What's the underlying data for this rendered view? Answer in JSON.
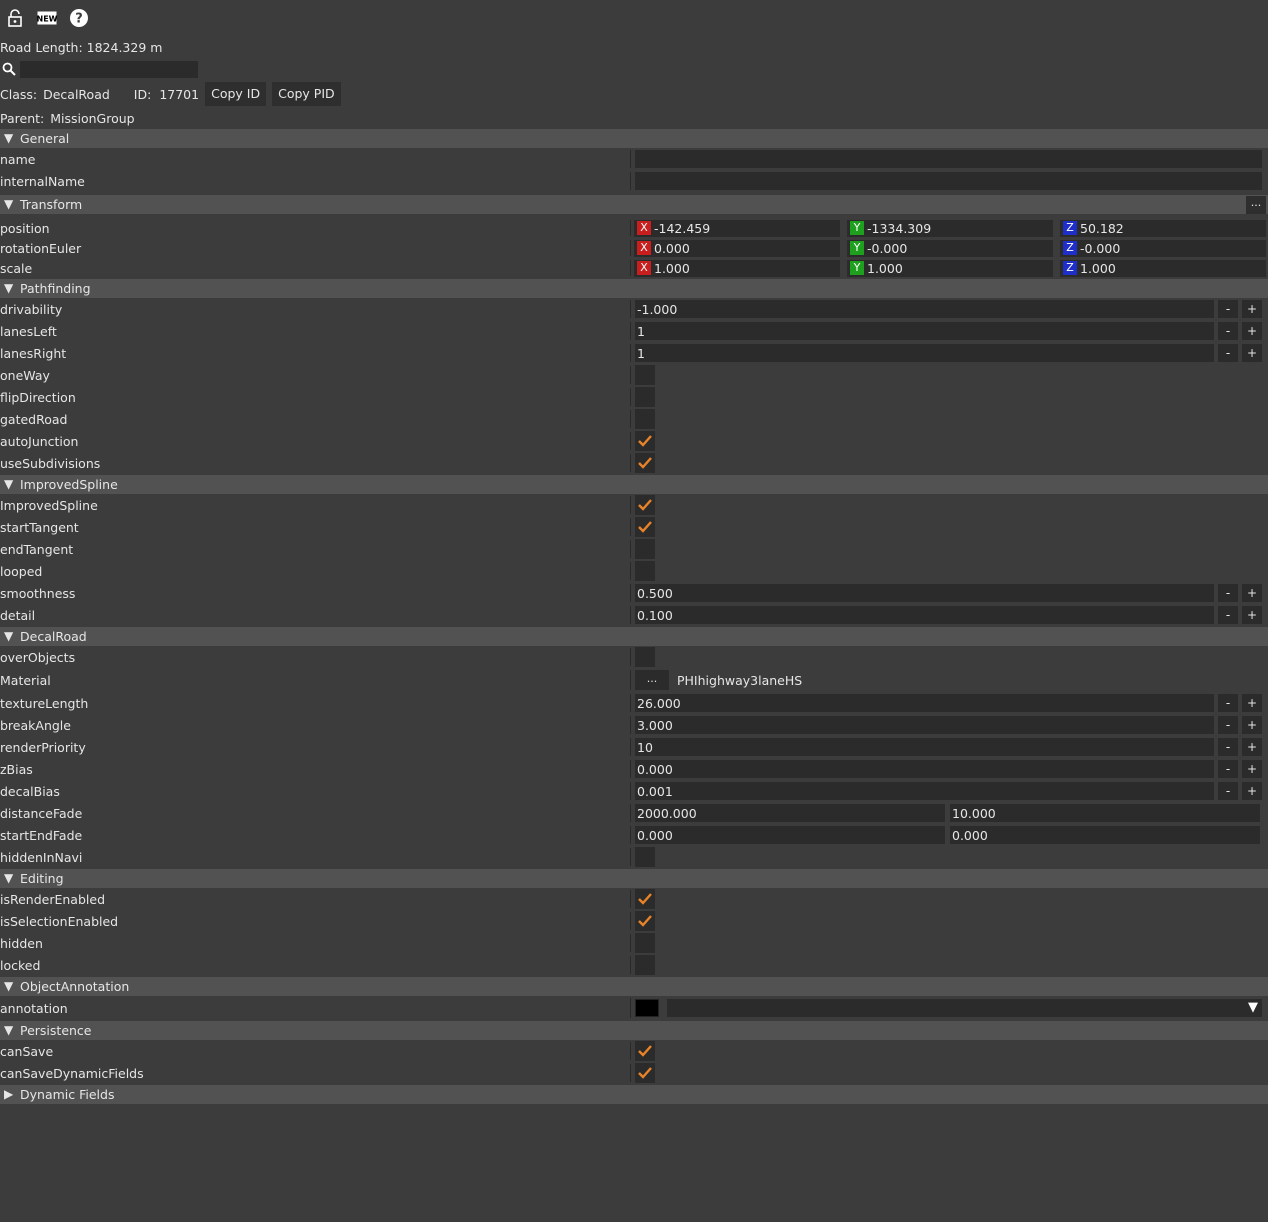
{
  "toolbar": {
    "icons": [
      "lock-icon",
      "new-icon",
      "help-icon"
    ],
    "new_label": "NEW",
    "help_label": "?"
  },
  "road_length": "Road Length: 1824.329 m",
  "search": {
    "placeholder": "",
    "value": ""
  },
  "class_label": "Class:",
  "class_value": "DecalRoad",
  "id_label": "ID:",
  "id_value": "17701",
  "copy_id": "Copy ID",
  "copy_pid": "Copy PID",
  "parent_label": "Parent:",
  "parent_value": "MissionGroup",
  "sections": {
    "general": "General",
    "transform": "Transform",
    "pathfinding": "Pathfinding",
    "improvedspline": "ImprovedSpline",
    "decalroad": "DecalRoad",
    "editing": "Editing",
    "objectannotation": "ObjectAnnotation",
    "persistence": "Persistence",
    "dynamic": "Dynamic Fields"
  },
  "transform_more": "...",
  "general": {
    "name_label": "name",
    "name_value": "",
    "internalName_label": "internalName",
    "internalName_value": ""
  },
  "axes": {
    "x": "X",
    "y": "Y",
    "z": "Z"
  },
  "transform": {
    "position": {
      "label": "position",
      "x": "-142.459",
      "y": "-1334.309",
      "z": "50.182"
    },
    "rotation": {
      "label": "rotationEuler",
      "x": "0.000",
      "y": "-0.000",
      "z": "-0.000"
    },
    "scale": {
      "label": "scale",
      "x": "1.000",
      "y": "1.000",
      "z": "1.000"
    }
  },
  "pm": {
    "minus": "-",
    "plus": "+"
  },
  "pathfinding": {
    "drivability": {
      "label": "drivability",
      "value": "-1.000"
    },
    "lanesLeft": {
      "label": "lanesLeft",
      "value": "1"
    },
    "lanesRight": {
      "label": "lanesRight",
      "value": "1"
    },
    "oneWay": {
      "label": "oneWay",
      "checked": false
    },
    "flipDirection": {
      "label": "flipDirection",
      "checked": false
    },
    "gatedRoad": {
      "label": "gatedRoad",
      "checked": false
    },
    "autoJunction": {
      "label": "autoJunction",
      "checked": true
    },
    "useSubdivisions": {
      "label": "useSubdivisions",
      "checked": true
    }
  },
  "improvedspline": {
    "improvedSpline": {
      "label": "ImprovedSpline",
      "checked": true
    },
    "startTangent": {
      "label": "startTangent",
      "checked": true
    },
    "endTangent": {
      "label": "endTangent",
      "checked": false
    },
    "looped": {
      "label": "looped",
      "checked": false
    },
    "smoothness": {
      "label": "smoothness",
      "value": "0.500"
    },
    "detail": {
      "label": "detail",
      "value": "0.100"
    }
  },
  "decalroad": {
    "overObjects": {
      "label": "overObjects",
      "checked": false
    },
    "material": {
      "label": "Material",
      "button": "...",
      "value": "PHIhighway3laneHS"
    },
    "textureLength": {
      "label": "textureLength",
      "value": "26.000"
    },
    "breakAngle": {
      "label": "breakAngle",
      "value": "3.000"
    },
    "renderPriority": {
      "label": "renderPriority",
      "value": "10"
    },
    "zBias": {
      "label": "zBias",
      "value": "0.000"
    },
    "decalBias": {
      "label": "decalBias",
      "value": "0.001"
    },
    "distanceFade": {
      "label": "distanceFade",
      "a": "2000.000",
      "b": "10.000"
    },
    "startEndFade": {
      "label": "startEndFade",
      "a": "0.000",
      "b": "0.000"
    },
    "hiddenInNavi": {
      "label": "hiddenInNavi",
      "checked": false
    }
  },
  "editing": {
    "isRenderEnabled": {
      "label": "isRenderEnabled",
      "checked": true
    },
    "isSelectionEnabled": {
      "label": "isSelectionEnabled",
      "checked": true
    },
    "hidden": {
      "label": "hidden",
      "checked": false
    },
    "locked": {
      "label": "locked",
      "checked": false
    }
  },
  "objectannotation": {
    "annotation": {
      "label": "annotation",
      "color": "#000000",
      "value": ""
    }
  },
  "persistence": {
    "canSave": {
      "label": "canSave",
      "checked": true
    },
    "canSaveDynamicFields": {
      "label": "canSaveDynamicFields",
      "checked": true
    }
  },
  "colors": {
    "accent": "#e8832a",
    "x": "#c81e1e",
    "y": "#1ea01e",
    "z": "#1e2ec8"
  }
}
